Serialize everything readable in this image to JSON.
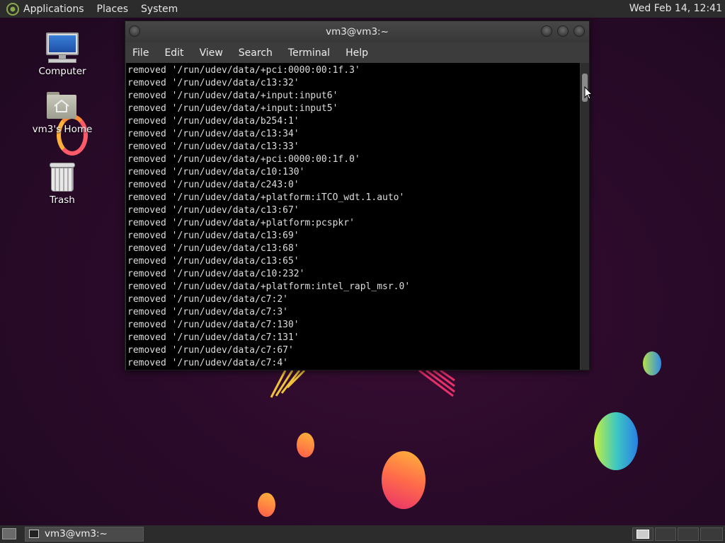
{
  "top_panel": {
    "menus": [
      "Applications",
      "Places",
      "System"
    ],
    "clock": "Wed Feb 14, 12:41"
  },
  "desktop_icons": [
    {
      "label": "Computer",
      "icon": "computer-icon"
    },
    {
      "label": "vm3's Home",
      "icon": "home-folder-icon"
    },
    {
      "label": "Trash",
      "icon": "trash-icon"
    }
  ],
  "terminal": {
    "title": "vm3@vm3:~",
    "menu": [
      "File",
      "Edit",
      "View",
      "Search",
      "Terminal",
      "Help"
    ],
    "lines": [
      "removed '/run/udev/data/+pci:0000:00:1f.3'",
      "removed '/run/udev/data/c13:32'",
      "removed '/run/udev/data/+input:input6'",
      "removed '/run/udev/data/+input:input5'",
      "removed '/run/udev/data/b254:1'",
      "removed '/run/udev/data/c13:34'",
      "removed '/run/udev/data/c13:33'",
      "removed '/run/udev/data/+pci:0000:00:1f.0'",
      "removed '/run/udev/data/c10:130'",
      "removed '/run/udev/data/c243:0'",
      "removed '/run/udev/data/+platform:iTCO_wdt.1.auto'",
      "removed '/run/udev/data/c13:67'",
      "removed '/run/udev/data/+platform:pcspkr'",
      "removed '/run/udev/data/c13:69'",
      "removed '/run/udev/data/c13:68'",
      "removed '/run/udev/data/c13:65'",
      "removed '/run/udev/data/c10:232'",
      "removed '/run/udev/data/+platform:intel_rapl_msr.0'",
      "removed '/run/udev/data/c7:2'",
      "removed '/run/udev/data/c7:3'",
      "removed '/run/udev/data/c7:130'",
      "removed '/run/udev/data/c7:131'",
      "removed '/run/udev/data/c7:67'",
      "removed '/run/udev/data/c7:4'"
    ]
  },
  "taskbar": {
    "tasks": [
      {
        "label": "vm3@vm3:~",
        "icon": "terminal-icon"
      }
    ]
  },
  "colors": {
    "panel": "#2c2c2c",
    "terminal_bg": "#000000",
    "terminal_fg": "#dcdcdc"
  }
}
